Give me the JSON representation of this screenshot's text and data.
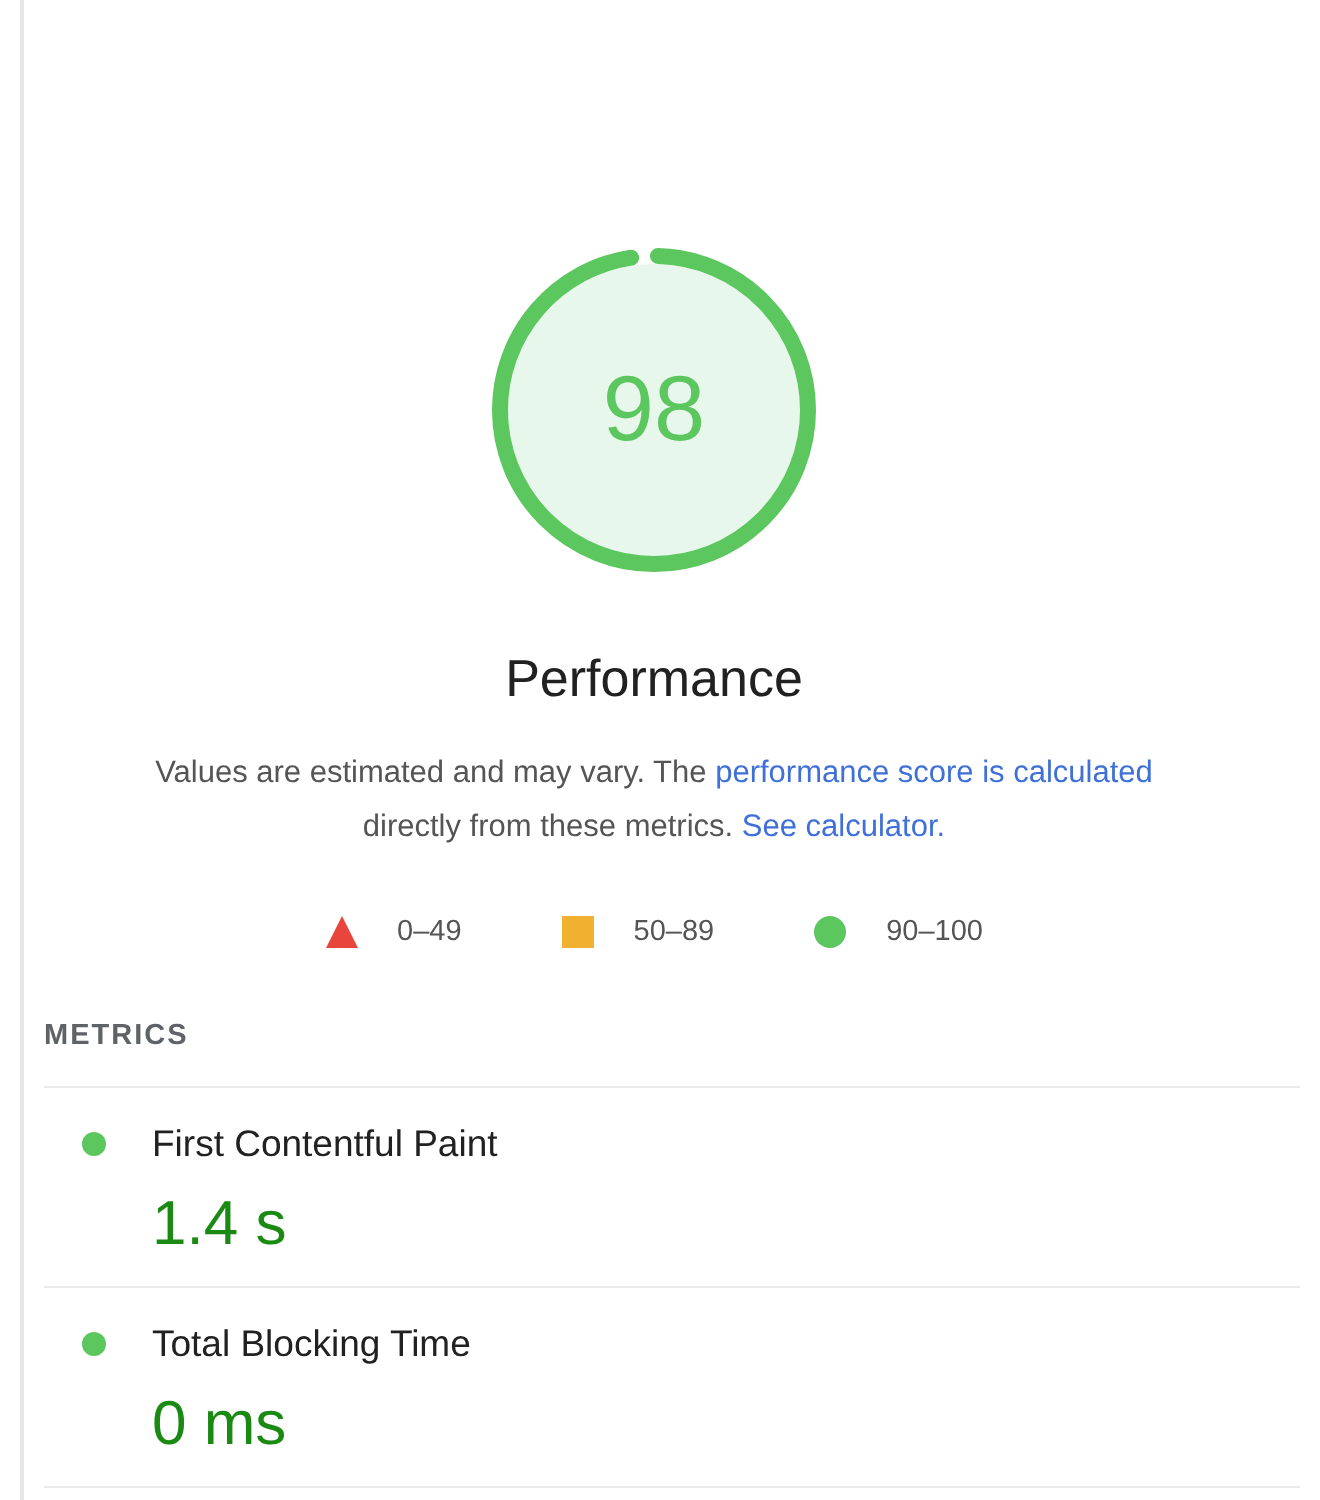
{
  "gauge": {
    "score": "98",
    "level": 0.98,
    "title": "Performance"
  },
  "description": [
    {
      "kind": "text",
      "text": "Values are estimated and may vary. The "
    },
    {
      "kind": "link",
      "text": "performance score is calculated"
    },
    {
      "kind": "text",
      "text": " directly from these metrics. "
    },
    {
      "kind": "link",
      "text": "See calculator."
    }
  ],
  "legend": [
    {
      "kind": "fail",
      "range": "0–49"
    },
    {
      "kind": "average",
      "range": "50–89"
    },
    {
      "kind": "pass",
      "range": "90–100"
    }
  ],
  "metrics_section": {
    "title": "METRICS",
    "metrics": [
      {
        "kind": "pass",
        "name": "First Contentful Paint",
        "value": "1.4 s"
      },
      {
        "kind": "pass",
        "name": "Total Blocking Time",
        "value": "0 ms"
      }
    ]
  }
}
